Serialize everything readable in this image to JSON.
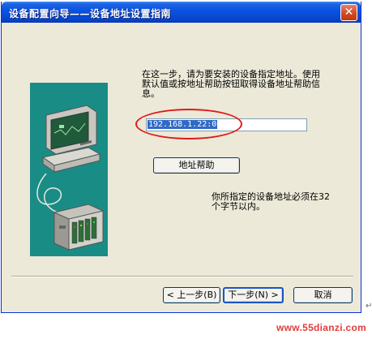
{
  "window": {
    "title": "设备配置向导——设备地址设置指南",
    "close_glyph": "✕"
  },
  "content": {
    "instruction": "在这一步，请为要安装的设备指定地址。使用默认值或按地址帮助按钮取得设备地址帮助信息。",
    "address_value": "192.168.1.22:0",
    "help_button_label": "地址帮助",
    "note": "你所指定的设备地址必须在32个字节以内。"
  },
  "footer": {
    "back_label": "< 上一步(B)",
    "next_label": "下一步(N) >",
    "cancel_label": "取消"
  },
  "watermark": "www.55dianzi.com",
  "colors": {
    "title_bar": "#0a54e3",
    "window_bg": "#ece9d8",
    "illustration_bg": "#1a8c86",
    "annotation_ring": "#e01a1a"
  },
  "icons": [
    "computer-icon",
    "device-rack-icon",
    "close-icon"
  ]
}
